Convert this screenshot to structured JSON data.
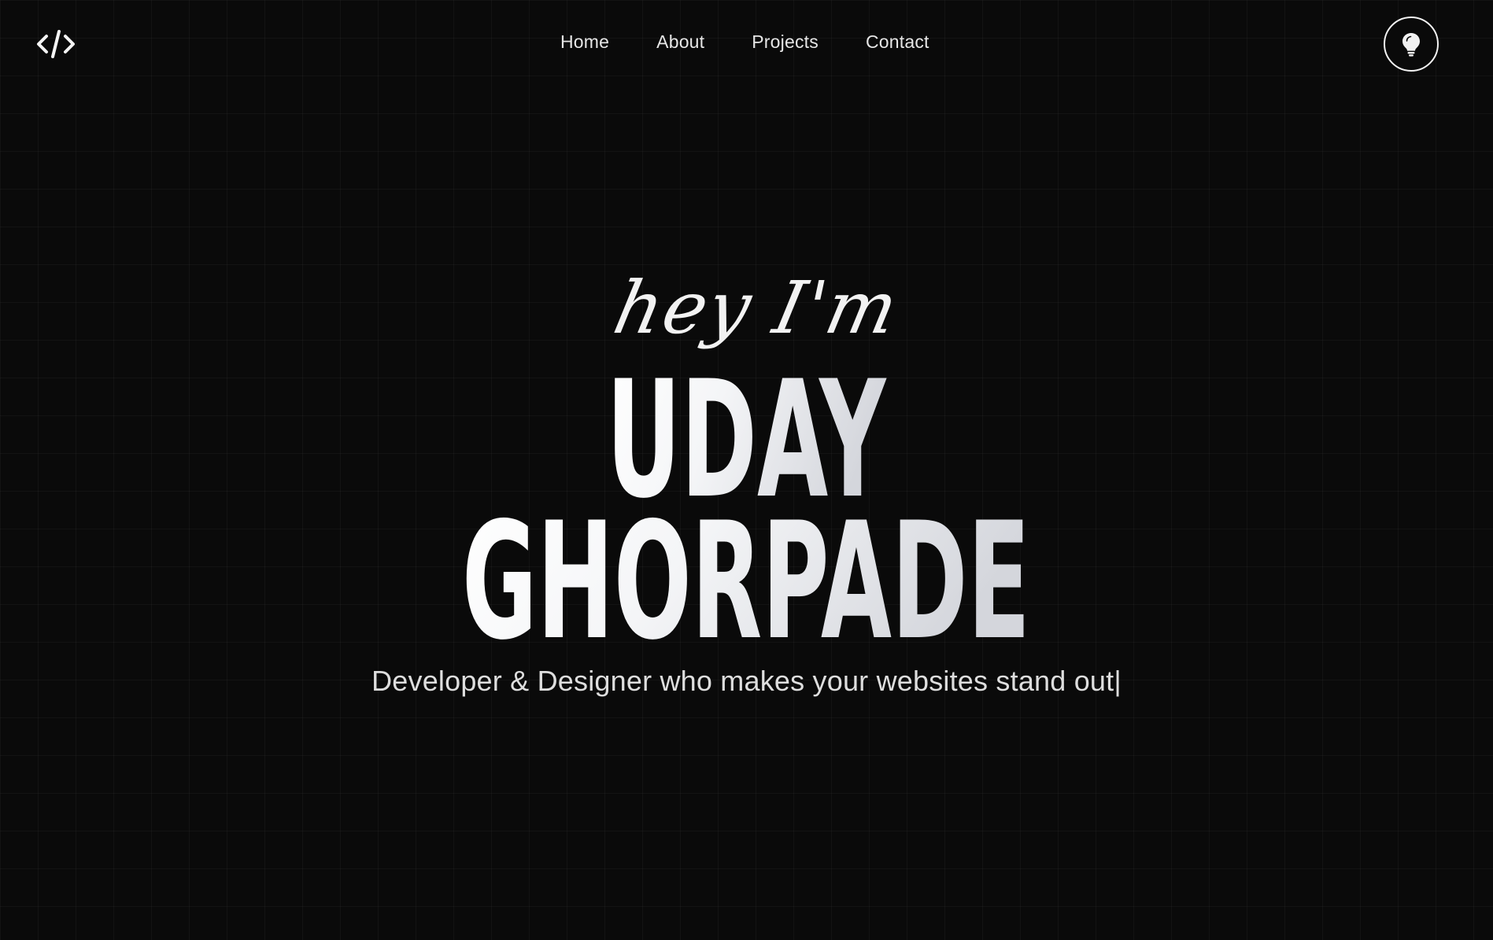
{
  "header": {
    "logo_icon": "code-brackets-icon",
    "nav": {
      "home": "Home",
      "about": "About",
      "projects": "Projects",
      "contact": "Contact"
    },
    "theme_toggle_icon": "lightbulb-icon"
  },
  "hero": {
    "greeting": "hey I'm",
    "first_name": "UDAY",
    "last_name": "GHORPADE",
    "tagline": "Developer & Designer who makes your websites stand out",
    "cursor": "|"
  },
  "colors": {
    "background": "#0a0a0a",
    "text": "#e8e8e8",
    "name_gradient_start": "#ffffff",
    "name_gradient_end": "#d4d6dc"
  }
}
